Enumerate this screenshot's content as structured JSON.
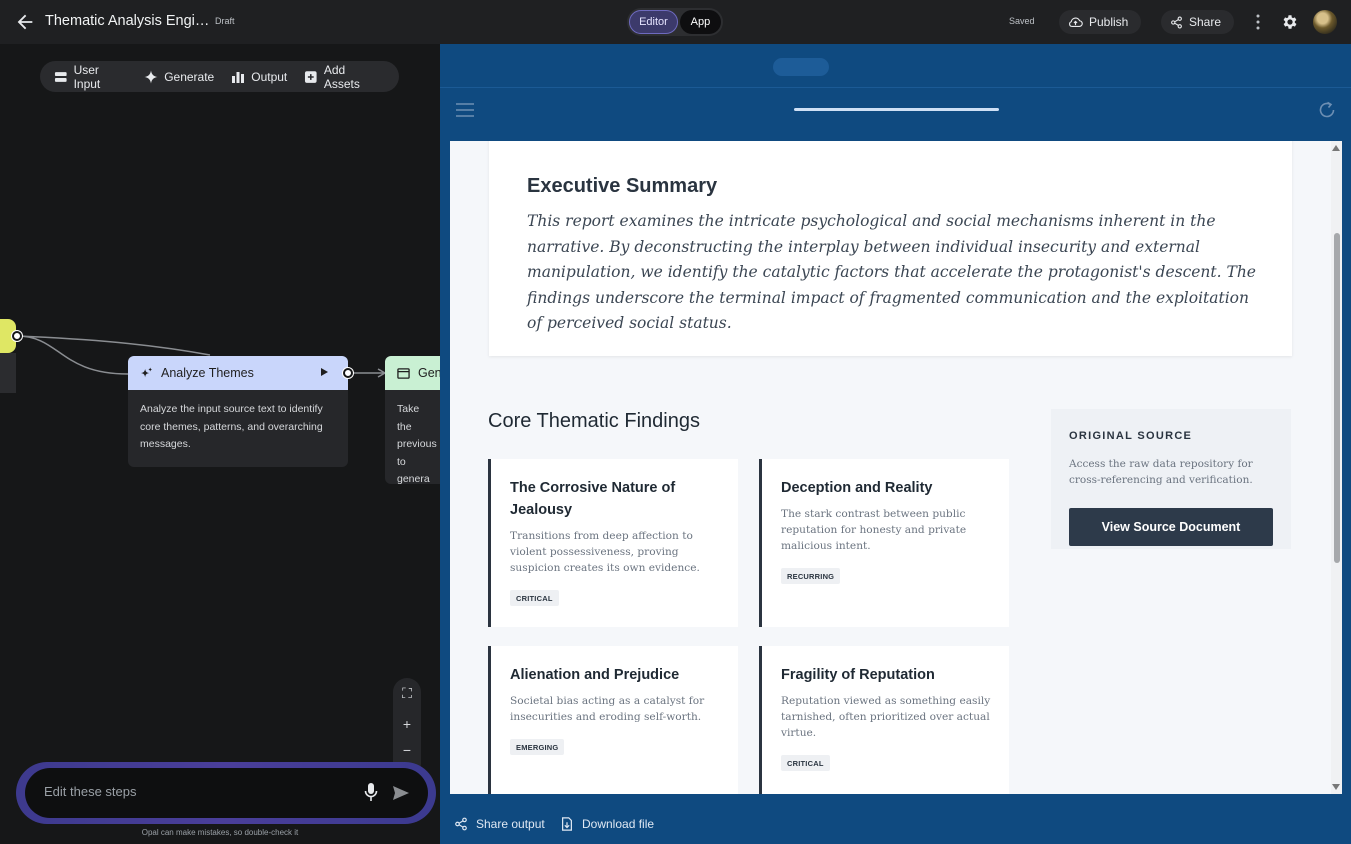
{
  "topbar": {
    "title": "Thematic Analysis Engi…",
    "draft": "Draft",
    "modes": {
      "editor": "Editor",
      "app": "App"
    },
    "saved": "Saved",
    "publish": "Publish",
    "share": "Share"
  },
  "toolbar": {
    "user_input": "User Input",
    "generate": "Generate",
    "output": "Output",
    "add_assets": "Add Assets"
  },
  "nodes": {
    "analyze": {
      "title": "Analyze Themes",
      "body": "Analyze the input source text to identify core themes, patterns, and overarching messages."
    },
    "generate": {
      "title": "Gen",
      "body": "Take the previous to genera HTML do"
    }
  },
  "editbar": {
    "placeholder": "Edit these steps",
    "disclaimer": "Opal can make mistakes, so double-check it"
  },
  "report": {
    "exec_title": "Executive Summary",
    "exec_text": "This report examines the intricate psychological and social mechanisms inherent in the narrative. By deconstructing the interplay between individual insecurity and external manipulation, we identify the catalytic factors that accelerate the protagonist's descent. The findings underscore the terminal impact of fragmented communication and the exploitation of perceived social status.",
    "core_title": "Core Thematic Findings",
    "cards": [
      {
        "title": "The Corrosive Nature of Jealousy",
        "desc": "Transitions from deep affection to violent possessiveness, proving suspicion creates its own evidence.",
        "tag": "CRITICAL"
      },
      {
        "title": "Deception and Reality",
        "desc": "The stark contrast between public reputation for honesty and private malicious intent.",
        "tag": "RECURRING"
      },
      {
        "title": "Alienation and Prejudice",
        "desc": "Societal bias acting as a catalyst for insecurities and eroding self-worth.",
        "tag": "EMERGING"
      },
      {
        "title": "Fragility of Reputation",
        "desc": "Reputation viewed as something easily tarnished, often prioritized over actual virtue.",
        "tag": "CRITICAL"
      }
    ],
    "source": {
      "label": "ORIGINAL SOURCE",
      "desc": "Access the raw data repository for cross-referencing and verification.",
      "button": "View Source Document"
    }
  },
  "footer": {
    "share_output": "Share output",
    "download": "Download file"
  },
  "colors": {
    "preview_bg": "#0f4a80",
    "analyze_header": "#c9d6fb",
    "generate_header": "#c9f0d3",
    "input_node": "#dfe764",
    "source_button": "#2d3a4a"
  }
}
